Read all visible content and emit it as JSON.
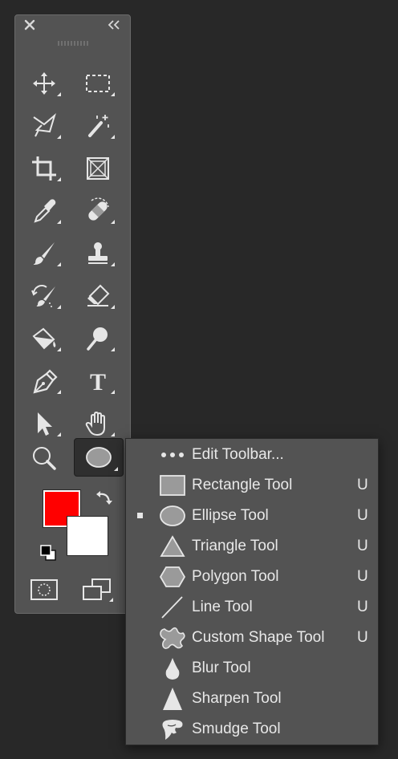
{
  "panel": {
    "close_icon": "close-icon",
    "collapse_icon": "double-chevron-left-icon"
  },
  "tools": [
    {
      "name": "move-tool",
      "icon": "move-icon"
    },
    {
      "name": "rectangular-marquee-tool",
      "icon": "marquee-icon"
    },
    {
      "name": "polygonal-lasso-tool",
      "icon": "lasso-icon"
    },
    {
      "name": "magic-wand-tool",
      "icon": "magic-wand-icon"
    },
    {
      "name": "crop-tool",
      "icon": "crop-icon"
    },
    {
      "name": "frame-tool",
      "icon": "frame-icon"
    },
    {
      "name": "eyedropper-tool",
      "icon": "eyedropper-icon"
    },
    {
      "name": "healing-brush-tool",
      "icon": "bandage-icon"
    },
    {
      "name": "brush-tool",
      "icon": "brush-icon"
    },
    {
      "name": "clone-stamp-tool",
      "icon": "stamp-icon"
    },
    {
      "name": "history-brush-tool",
      "icon": "history-brush-icon"
    },
    {
      "name": "eraser-tool",
      "icon": "eraser-icon"
    },
    {
      "name": "paint-bucket-tool",
      "icon": "paint-bucket-icon"
    },
    {
      "name": "dodge-tool",
      "icon": "dodge-icon"
    },
    {
      "name": "pen-tool",
      "icon": "pen-icon"
    },
    {
      "name": "type-tool",
      "icon": "type-icon",
      "glyph": "T"
    },
    {
      "name": "path-selection-tool",
      "icon": "arrow-icon"
    },
    {
      "name": "hand-tool",
      "icon": "hand-icon"
    },
    {
      "name": "zoom-tool",
      "icon": "magnifier-icon"
    },
    {
      "name": "ellipse-tool",
      "icon": "ellipse-icon",
      "active": true
    }
  ],
  "colors": {
    "foreground": "#ff0000",
    "background": "#ffffff",
    "panel_bg": "#535353",
    "app_bg": "#282828"
  },
  "menu": {
    "items": [
      {
        "label": "Edit Toolbar...",
        "shortcut": "",
        "icon": "more-dots-icon",
        "selected": false
      },
      {
        "label": "Rectangle Tool",
        "shortcut": "U",
        "icon": "rectangle-icon",
        "selected": false
      },
      {
        "label": "Ellipse Tool",
        "shortcut": "U",
        "icon": "ellipse-icon",
        "selected": true
      },
      {
        "label": "Triangle Tool",
        "shortcut": "U",
        "icon": "triangle-icon",
        "selected": false
      },
      {
        "label": "Polygon Tool",
        "shortcut": "U",
        "icon": "hexagon-icon",
        "selected": false
      },
      {
        "label": "Line Tool",
        "shortcut": "U",
        "icon": "line-icon",
        "selected": false
      },
      {
        "label": "Custom Shape Tool",
        "shortcut": "U",
        "icon": "custom-shape-icon",
        "selected": false
      },
      {
        "label": "Blur Tool",
        "shortcut": "",
        "icon": "drop-icon",
        "selected": false
      },
      {
        "label": "Sharpen Tool",
        "shortcut": "",
        "icon": "cone-icon",
        "selected": false
      },
      {
        "label": "Smudge Tool",
        "shortcut": "",
        "icon": "finger-icon",
        "selected": false
      }
    ]
  }
}
